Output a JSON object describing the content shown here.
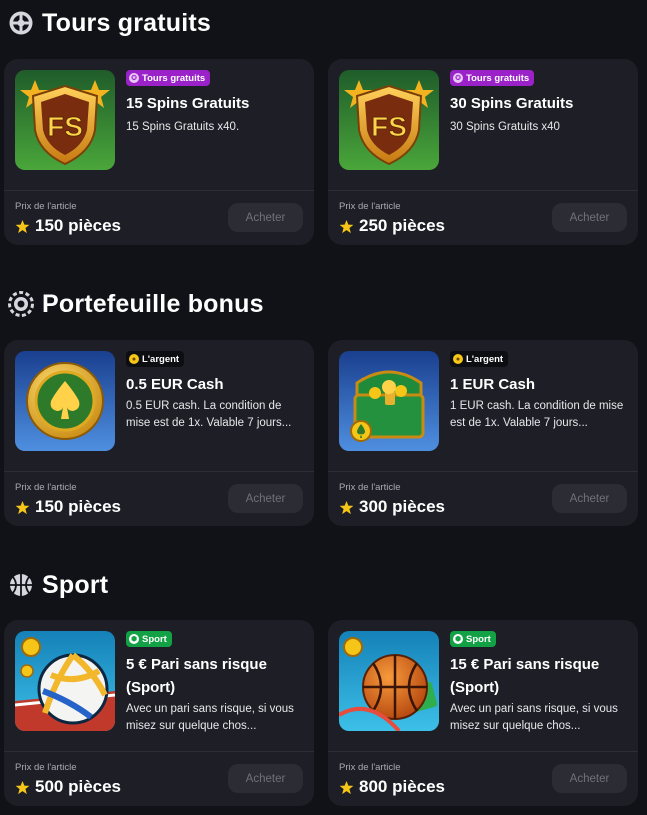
{
  "price_label": "Prix de l'article",
  "buy_label": "Acheter",
  "sections": [
    {
      "title": "Tours gratuits",
      "cards": [
        {
          "badge": "Tours gratuits",
          "title": "15 Spins Gratuits",
          "desc": "15 Spins Gratuits x40.",
          "price": "150 pièces"
        },
        {
          "badge": "Tours gratuits",
          "title": "30 Spins Gratuits",
          "desc": "30 Spins Gratuits x40",
          "price": "250 pièces"
        }
      ]
    },
    {
      "title": "Portefeuille bonus",
      "cards": [
        {
          "badge": "L'argent",
          "title": "0.5 EUR Cash",
          "desc": "0.5 EUR cash. La condition de mise est de 1x. Valable 7 jours...",
          "price": "150 pièces"
        },
        {
          "badge": "L'argent",
          "title": "1 EUR Cash",
          "desc": "1 EUR cash. La condition de mise est de 1x. Valable 7 jours...",
          "price": "300 pièces"
        }
      ]
    },
    {
      "title": "Sport",
      "cards": [
        {
          "badge": "Sport",
          "title": "5 € Pari sans risque (Sport)",
          "desc": "Avec un pari sans risque, si vous misez sur quelque chos...",
          "price": "500 pièces"
        },
        {
          "badge": "Sport",
          "title": "15 € Pari sans risque (Sport)",
          "desc": "Avec un pari sans risque, si vous misez sur quelque chos...",
          "price": "800 pièces"
        }
      ]
    }
  ],
  "thumb_text": "FS",
  "icons": {
    "free_spins_section": "spin-reel-icon",
    "bonus_section": "chip-icon",
    "sport_section": "basketball-icon",
    "price": "star-icon",
    "badge_free_spins": "spin-icon",
    "badge_money": "coins-icon",
    "badge_sport": "soccer-ball-icon"
  },
  "colors": {
    "background": "#111217",
    "card": "#1e1f26",
    "badge_free_spins": "#9b22c9",
    "badge_money": "#0d0e12",
    "badge_sport": "#13a146",
    "star": "#f5c518",
    "button_bg": "#2b2c34",
    "button_text": "#6f717c"
  }
}
